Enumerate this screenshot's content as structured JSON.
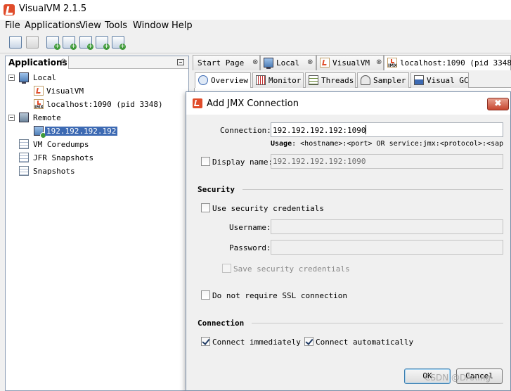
{
  "window": {
    "title": "VisualVM 2.1.5"
  },
  "menu": [
    "File",
    "Applications",
    "View",
    "Tools",
    "Window",
    "Help"
  ],
  "toolbar": {
    "buttons": [
      "load-snapshot-icon",
      "save-icon",
      "add-jmx-connection-icon",
      "add-remote-host-icon",
      "add-vm-coredump-icon",
      "heap-dump-icon",
      "thread-dump-icon"
    ],
    "jmx_badge": "JMX"
  },
  "applications_panel": {
    "tab_label": "Applications",
    "close_glyph": "⊗",
    "tree": {
      "local": "Local",
      "visualvm": "VisualVM",
      "localhost": "localhost:1090 (pid 3348)",
      "remote": "Remote",
      "remote_host": "192.192.192.192",
      "vm_coredumps": "VM Coredumps",
      "jfr_snapshots": "JFR Snapshots",
      "snapshots": "Snapshots"
    }
  },
  "document_tabs": {
    "start_page": "Start Page",
    "local": "Local",
    "visualvm": "VisualVM",
    "localhost": "localhost:1090 (pid 3348)"
  },
  "sub_tabs": {
    "overview": "Overview",
    "monitor": "Monitor",
    "threads": "Threads",
    "sampler": "Sampler",
    "visual_gc": "Visual GC"
  },
  "dialog": {
    "title": "Add JMX Connection",
    "close_glyph": "✖",
    "connection_label": "Connection:",
    "connection_value": "192.192.192.192:1090",
    "usage_label": "Usage",
    "usage_text": ": <hostname>:<port> OR service:jmx:<protocol>:<sap",
    "display_name_label": "Display name:",
    "display_name_placeholder": "192.192.192.192:1090",
    "security_section": "Security",
    "use_security_label": "Use security credentials",
    "username_label": "Username:",
    "password_label": "Password:",
    "save_credentials_label": "Save security credentials",
    "no_ssl_label": "Do not require SSL connection",
    "connection_section": "Connection",
    "connect_immediately_label": "Connect immediately",
    "connect_automatically_label": "Connect automatically",
    "ok_label": "OK",
    "cancel_label": "Cancel"
  },
  "watermark": "CSDN @DAXing"
}
